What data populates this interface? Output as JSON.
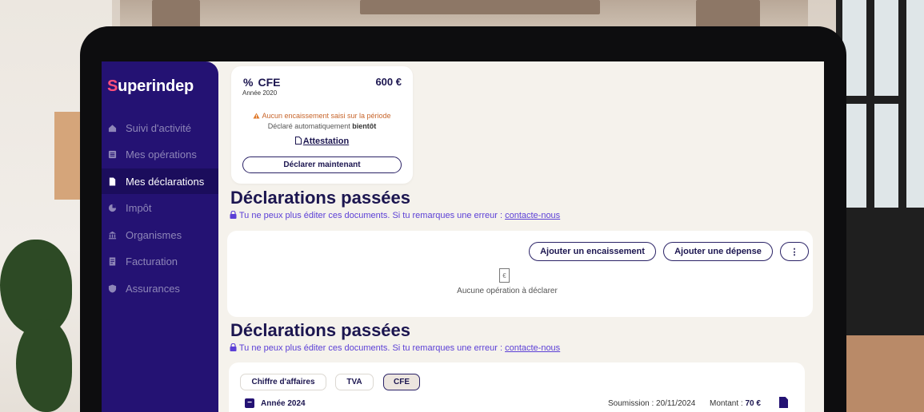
{
  "brand": {
    "name_prefix": "S",
    "name_rest": "uperindep"
  },
  "sidebar": {
    "items": [
      {
        "label": "Suivi d'activité",
        "icon": "house-icon",
        "active": false
      },
      {
        "label": "Mes opérations",
        "icon": "list-icon",
        "active": false
      },
      {
        "label": "Mes déclarations",
        "icon": "document-icon",
        "active": true
      },
      {
        "label": "Impôt",
        "icon": "pie-chart-icon",
        "active": false
      },
      {
        "label": "Organismes",
        "icon": "bank-icon",
        "active": false
      },
      {
        "label": "Facturation",
        "icon": "invoice-icon",
        "active": false
      },
      {
        "label": "Assurances",
        "icon": "shield-icon",
        "active": false
      }
    ]
  },
  "cfe_card": {
    "icon": "%",
    "title": "CFE",
    "year": "Année 2020",
    "amount": "600 €",
    "warning": "Aucun encaissement saisi sur la période",
    "auto_prefix": "Déclaré automatiquement",
    "auto_when": "bientôt",
    "attestation": "Attestation",
    "declare_button": "Déclarer maintenant"
  },
  "past_section_1": {
    "title": "Déclarations passées",
    "note": "Tu ne peux plus éditer ces documents. Si tu remarques une erreur :",
    "contact_link": "contacte-nous"
  },
  "operations": {
    "add_income_button": "Ajouter un encaissement",
    "add_expense_button": "Ajouter une dépense",
    "more_button": "⋮",
    "empty_icon_glyph": "€",
    "empty_text": "Aucune opération à déclarer"
  },
  "past_section_2": {
    "title": "Déclarations passées",
    "note": "Tu ne peux plus éditer ces documents. Si tu remarques une erreur :",
    "contact_link": "contacte-nous",
    "tabs": [
      {
        "label": "Chiffre d'affaires",
        "active": false
      },
      {
        "label": "TVA",
        "active": false
      },
      {
        "label": "CFE",
        "active": true
      }
    ],
    "year_row": {
      "toggle": "−",
      "label": "Année 2024",
      "submission_label": "Soumission : 20/11/2024",
      "amount_label": "Montant :",
      "amount_value": "70 €"
    }
  },
  "colors": {
    "sidebar_bg": "#241273",
    "active_item_bg": "#1b0d5c",
    "accent": "#5b3fd6",
    "warning": "#c8652b",
    "brand_dot": "#ff4f7b"
  }
}
